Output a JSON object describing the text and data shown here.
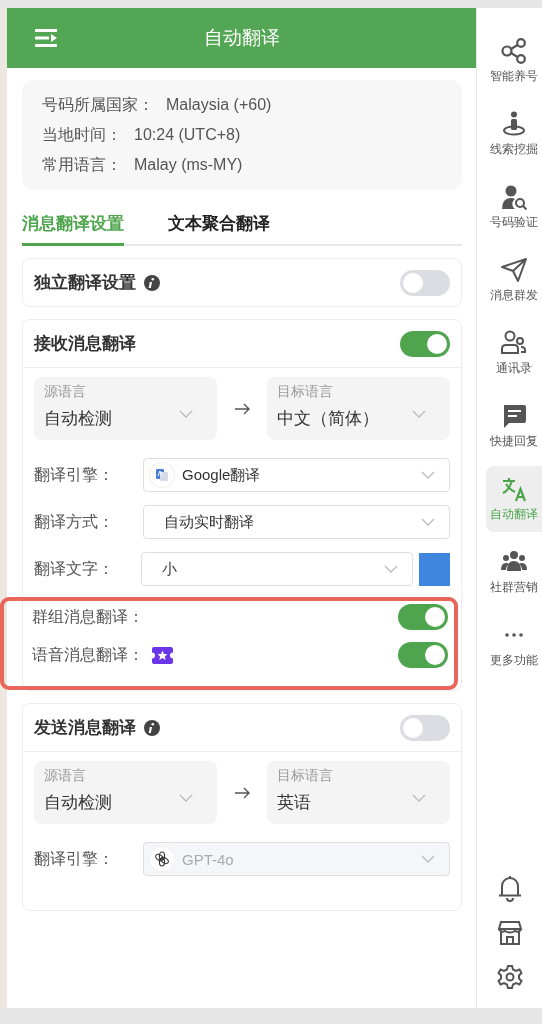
{
  "header": {
    "title": "自动翻译"
  },
  "info": [
    {
      "label": "号码所属国家：",
      "value": "Malaysia (+60)"
    },
    {
      "label": "当地时间：",
      "value": "10:24 (UTC+8)"
    },
    {
      "label": "常用语言：",
      "value": "Malay (ms-MY)"
    }
  ],
  "tabs": [
    {
      "label": "消息翻译设置",
      "selected": true
    },
    {
      "label": "文本聚合翻译",
      "selected": false
    }
  ],
  "independent": {
    "title": "独立翻译设置",
    "on": false
  },
  "receive": {
    "title": "接收消息翻译",
    "on": true,
    "source": {
      "label": "源语言",
      "value": "自动检测"
    },
    "target": {
      "label": "目标语言",
      "value": "中文（简体）"
    },
    "engine": {
      "label": "翻译引擎：",
      "value": "Google翻译",
      "disabled": false
    },
    "mode": {
      "label": "翻译方式：",
      "value": "自动实时翻译"
    },
    "text_size": {
      "label": "翻译文字：",
      "value": "小",
      "color": "#3f86de"
    },
    "toggles": [
      {
        "label": "群组消息翻译：",
        "on": true,
        "premium": false
      },
      {
        "label": "语音消息翻译：",
        "on": true,
        "premium": true
      }
    ]
  },
  "send": {
    "title": "发送消息翻译",
    "on": false,
    "source": {
      "label": "源语言",
      "value": "自动检测"
    },
    "target": {
      "label": "目标语言",
      "value": "英语"
    },
    "engine": {
      "label": "翻译引擎：",
      "value": "GPT-4o",
      "disabled": true
    }
  },
  "sidebar": {
    "items": [
      {
        "label": "智能养号",
        "selected": false
      },
      {
        "label": "线索挖掘",
        "selected": false
      },
      {
        "label": "号码验证",
        "selected": false
      },
      {
        "label": "消息群发",
        "selected": false
      },
      {
        "label": "通讯录",
        "selected": false
      },
      {
        "label": "快捷回复",
        "selected": false
      },
      {
        "label": "自动翻译",
        "selected": true
      },
      {
        "label": "社群营销",
        "selected": false
      },
      {
        "label": "更多功能",
        "selected": false
      }
    ]
  }
}
